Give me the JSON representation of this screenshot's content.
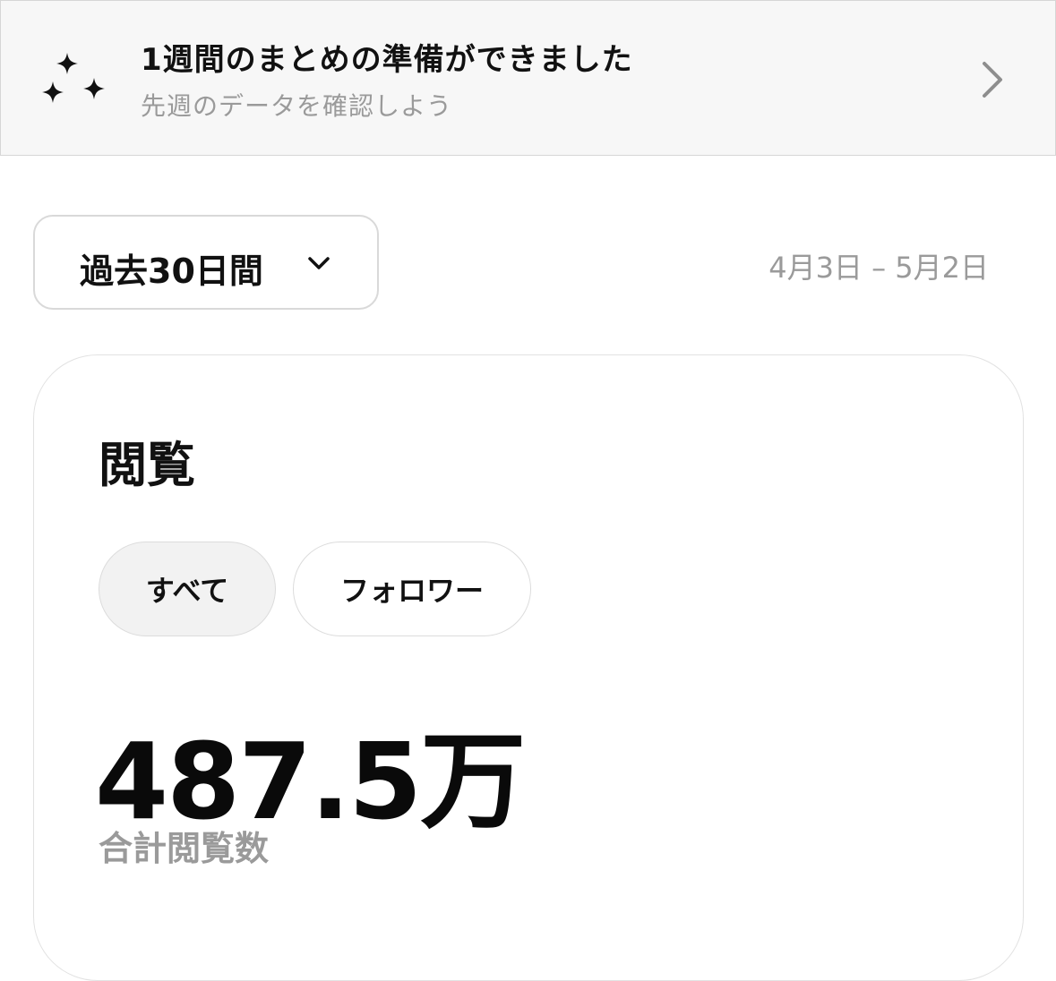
{
  "banner": {
    "icon": "sparkles-icon",
    "title": "1週間のまとめの準備ができました",
    "subtitle": "先週のデータを確認しよう",
    "chevron_icon": "chevron-right-icon"
  },
  "period": {
    "selected": "過去30日間",
    "dropdown_icon": "chevron-down-icon",
    "date_range": "4月3日 – 5月2日"
  },
  "card": {
    "title": "閲覧",
    "filters": [
      {
        "label": "すべて",
        "selected": true
      },
      {
        "label": "フォロワー",
        "selected": false
      }
    ],
    "total_value": "487.5万",
    "total_caption": "合計閲覧数"
  },
  "colors": {
    "banner_bg": "#f7f7f7",
    "muted_text": "#9a9a9a",
    "selected_chip_bg": "#f2f2f2"
  }
}
